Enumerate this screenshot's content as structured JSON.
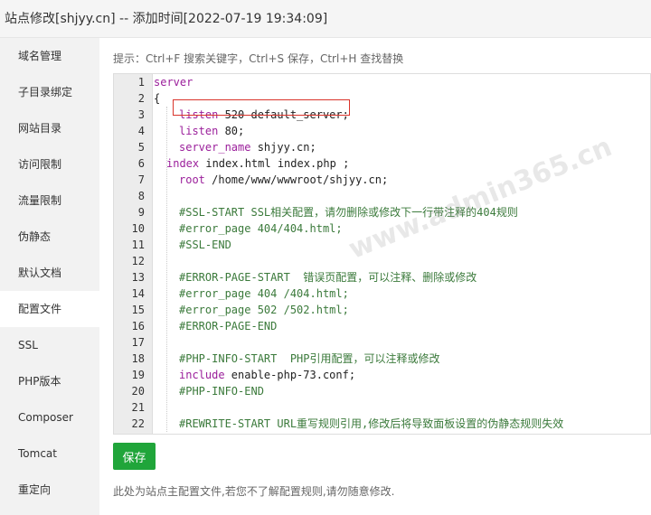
{
  "window": {
    "title": "站点修改[shjyy.cn] -- 添加时间[2022-07-19 19:34:09]"
  },
  "sidebar": {
    "items": [
      {
        "label": "域名管理"
      },
      {
        "label": "子目录绑定"
      },
      {
        "label": "网站目录"
      },
      {
        "label": "访问限制"
      },
      {
        "label": "流量限制"
      },
      {
        "label": "伪静态"
      },
      {
        "label": "默认文档"
      },
      {
        "label": "配置文件"
      },
      {
        "label": "SSL"
      },
      {
        "label": "PHP版本"
      },
      {
        "label": "Composer"
      },
      {
        "label": "Tomcat"
      },
      {
        "label": "重定向"
      }
    ],
    "active": "配置文件"
  },
  "editor": {
    "tip": "提示：Ctrl+F 搜索关键字，Ctrl+S 保存，Ctrl+H 查找替换",
    "watermark": "www.admin365.cn",
    "lines": [
      {
        "n": "1",
        "indent": 0,
        "kw": "server",
        "rest": ""
      },
      {
        "n": "2",
        "indent": 0,
        "kw": "",
        "rest": "{"
      },
      {
        "n": "3",
        "indent": 2,
        "kw": "listen",
        "rest": " 520 default_server;"
      },
      {
        "n": "4",
        "indent": 2,
        "kw": "listen",
        "rest": " 80;"
      },
      {
        "n": "5",
        "indent": 2,
        "kw": "server_name",
        "rest": " shjyy.cn;"
      },
      {
        "n": "6",
        "indent": 1,
        "kw": "index",
        "rest": " index.html index.php ;"
      },
      {
        "n": "7",
        "indent": 2,
        "kw": "root",
        "rest": " /home/www/wwwroot/shjyy.cn;"
      },
      {
        "n": "8",
        "indent": 0,
        "kw": "",
        "rest": ""
      },
      {
        "n": "9",
        "indent": 2,
        "comment": "#SSL-START SSL相关配置，请勿删除或修改下一行带注释的404规则"
      },
      {
        "n": "10",
        "indent": 2,
        "comment": "#error_page 404/404.html;"
      },
      {
        "n": "11",
        "indent": 2,
        "comment": "#SSL-END"
      },
      {
        "n": "12",
        "indent": 0,
        "kw": "",
        "rest": ""
      },
      {
        "n": "13",
        "indent": 2,
        "comment": "#ERROR-PAGE-START  错误页配置，可以注释、删除或修改"
      },
      {
        "n": "14",
        "indent": 2,
        "comment": "#error_page 404 /404.html;"
      },
      {
        "n": "15",
        "indent": 2,
        "comment": "#error_page 502 /502.html;"
      },
      {
        "n": "16",
        "indent": 2,
        "comment": "#ERROR-PAGE-END"
      },
      {
        "n": "17",
        "indent": 0,
        "kw": "",
        "rest": ""
      },
      {
        "n": "18",
        "indent": 2,
        "comment": "#PHP-INFO-START  PHP引用配置，可以注释或修改"
      },
      {
        "n": "19",
        "indent": 2,
        "kw": "include",
        "rest": " enable-php-73.conf;"
      },
      {
        "n": "20",
        "indent": 2,
        "comment": "#PHP-INFO-END"
      },
      {
        "n": "21",
        "indent": 0,
        "kw": "",
        "rest": ""
      },
      {
        "n": "22",
        "indent": 2,
        "comment": "#REWRITE-START URL重写规则引用,修改后将导致面板设置的伪静态规则失效"
      }
    ]
  },
  "actions": {
    "save_label": "保存"
  },
  "footnote": "此处为站点主配置文件,若您不了解配置规则,请勿随意修改.",
  "colors": {
    "accent": "#20a53a",
    "keyword": "#9b1f9b",
    "comment": "#3b7a3b",
    "highlight_border": "#d9342b"
  }
}
